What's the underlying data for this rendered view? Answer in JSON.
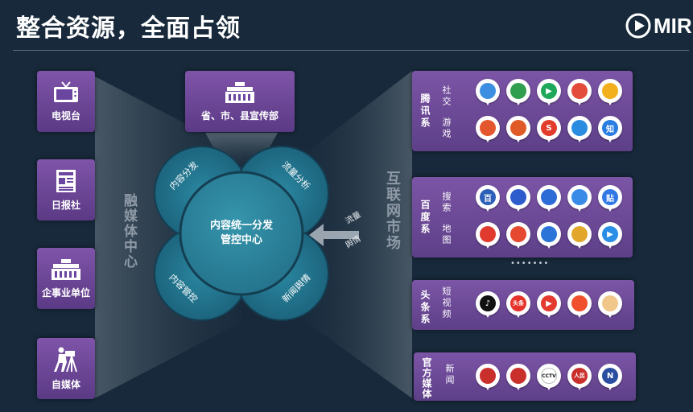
{
  "header": {
    "title": "整合资源，全面占领",
    "logo_text": "MIR"
  },
  "left_sources": [
    {
      "label": "电视台",
      "icon": "tv-icon"
    },
    {
      "label": "日报社",
      "icon": "newspaper-icon"
    },
    {
      "label": "企事业单位",
      "icon": "building-icon"
    },
    {
      "label": "自媒体",
      "icon": "camera-operator-icon"
    }
  ],
  "top_source": {
    "label": "省、市、县宣传部",
    "icon": "building-icon"
  },
  "left_vertical_label": "融媒体中心",
  "right_vertical_label": "互联网市场",
  "center": {
    "core_line1": "内容统一分发",
    "core_line2": "管控中心",
    "petals": [
      "内容分发",
      "流量分析",
      "内容管控",
      "新闻舆情"
    ]
  },
  "arrow_labels": [
    "流量",
    "舆情"
  ],
  "right_groups": [
    {
      "name": "腾讯系",
      "rows": [
        {
          "label": "社交",
          "apps": [
            {
              "icon": "qq-browser-icon",
              "color": "#3c8fe0",
              "glyph": ""
            },
            {
              "icon": "tencent-news-icon",
              "color": "#2f9e4e",
              "glyph": ""
            },
            {
              "icon": "tencent-video-icon",
              "color": "#20a85a",
              "glyph": "▶"
            },
            {
              "icon": "tencent-sports-icon",
              "color": "#e34b3b",
              "glyph": ""
            },
            {
              "icon": "qq-icon",
              "color": "#f2b01e",
              "glyph": ""
            }
          ]
        },
        {
          "label": "游戏",
          "apps": [
            {
              "icon": "tencent-game-icon",
              "color": "#e4572e",
              "glyph": ""
            },
            {
              "icon": "tencent-comic-icon",
              "color": "#e05a28",
              "glyph": ""
            },
            {
              "icon": "sogou-icon",
              "color": "#e23d2c",
              "glyph": "S"
            },
            {
              "icon": "qq-mail-icon",
              "color": "#2a8ce0",
              "glyph": ""
            },
            {
              "icon": "zhihu-icon",
              "color": "#2a7de0",
              "glyph": "知"
            }
          ]
        }
      ]
    },
    {
      "name": "百度系",
      "rows": [
        {
          "label": "搜索",
          "apps": [
            {
              "icon": "baidu-baike-icon",
              "color": "#2b5fb8",
              "glyph": "百"
            },
            {
              "icon": "baidu-paw-icon",
              "color": "#2d5ccd",
              "glyph": ""
            },
            {
              "icon": "baidu-app-icon",
              "color": "#2d6bd6",
              "glyph": ""
            },
            {
              "icon": "baidu-netdisk-icon",
              "color": "#3a8be8",
              "glyph": ""
            },
            {
              "icon": "baidu-tieba-icon",
              "color": "#2f78e6",
              "glyph": "贴"
            }
          ]
        },
        {
          "label": "地图",
          "apps": [
            {
              "icon": "baidu-news-icon",
              "color": "#e03a2e",
              "glyph": ""
            },
            {
              "icon": "baidu-map-icon",
              "color": "#e5492f",
              "glyph": ""
            },
            {
              "icon": "baidu-health-icon",
              "color": "#2d74d9",
              "glyph": ""
            },
            {
              "icon": "baidu-wallet-icon",
              "color": "#e2a62a",
              "glyph": ""
            },
            {
              "icon": "baidu-video-icon",
              "color": "#2a8de6",
              "glyph": "▶"
            }
          ]
        }
      ]
    },
    {
      "name": "头条系",
      "rows": [
        {
          "label": "短视频",
          "apps": [
            {
              "icon": "douyin-icon",
              "color": "#111111",
              "glyph": "♪"
            },
            {
              "icon": "toutiao-icon",
              "color": "#e5332a",
              "glyph": "头条"
            },
            {
              "icon": "xigua-video-icon",
              "color": "#e43a30",
              "glyph": "▶"
            },
            {
              "icon": "huoshan-video-icon",
              "color": "#f0502e",
              "glyph": ""
            },
            {
              "icon": "face-app-icon",
              "color": "#f0c68a",
              "glyph": ""
            }
          ]
        }
      ]
    },
    {
      "name": "官方媒体",
      "rows": [
        {
          "label": "新闻",
          "apps": [
            {
              "icon": "peoples-daily-icon",
              "color": "#c9302c",
              "glyph": ""
            },
            {
              "icon": "chinanews-icon",
              "color": "#c9302c",
              "glyph": ""
            },
            {
              "icon": "cctv-icon",
              "color": "#ffffff",
              "glyph": "CCTV"
            },
            {
              "icon": "renmin-icon",
              "color": "#c9302c",
              "glyph": "人民"
            },
            {
              "icon": "xinhua-icon",
              "color": "#2a4ea0",
              "glyph": "N"
            }
          ]
        }
      ]
    }
  ],
  "ellipsis": "•••••••",
  "colors": {
    "background": "#17293a",
    "tile_purple": "#6b46a0",
    "petal_teal": "#1e6f86",
    "core_teal": "#2b8aa0"
  }
}
